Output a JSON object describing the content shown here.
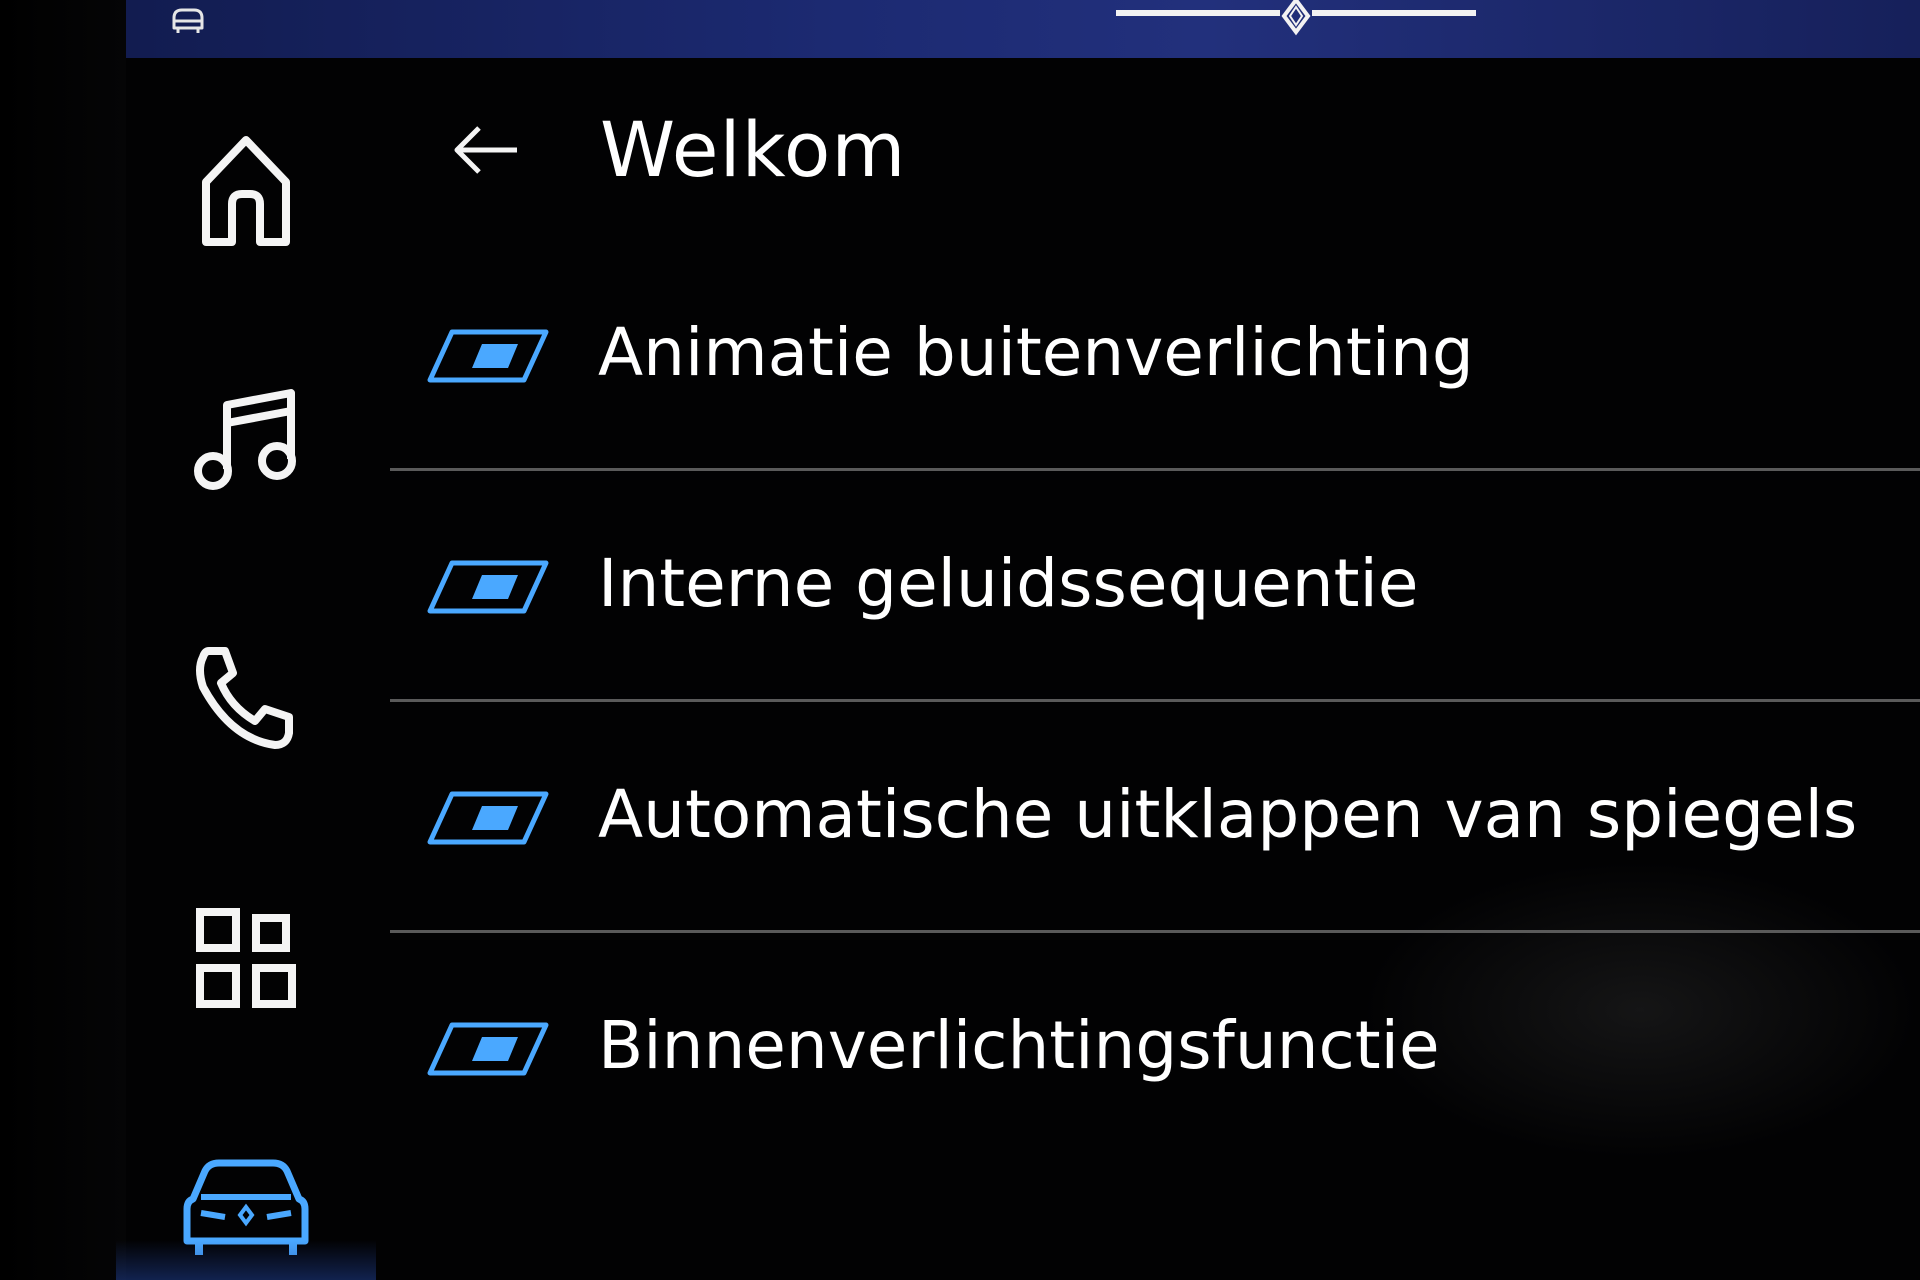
{
  "top_bar": {
    "car_icon": "car-outline-icon",
    "indicator_icon": "brand-diamond-icon",
    "accent_color": "#1c2a72"
  },
  "sidebar": {
    "items": [
      {
        "id": "home",
        "icon": "home-icon",
        "active": false
      },
      {
        "id": "music",
        "icon": "music-note-icon",
        "active": false
      },
      {
        "id": "phone",
        "icon": "phone-icon",
        "active": false
      },
      {
        "id": "apps",
        "icon": "apps-grid-icon",
        "active": false
      },
      {
        "id": "car",
        "icon": "car-icon",
        "active": true
      }
    ],
    "active_color": "#4aa8ff"
  },
  "header": {
    "back_icon": "arrow-left-icon",
    "title": "Welkom"
  },
  "menu": {
    "items": [
      {
        "label": "Animatie buitenverlichting",
        "icon": "parallelogram-icon"
      },
      {
        "label": "Interne geluidssequentie",
        "icon": "parallelogram-icon"
      },
      {
        "label": "Automatische uitklappen van spiegels",
        "icon": "parallelogram-icon"
      },
      {
        "label": "Binnenverlichtingsfunctie",
        "icon": "parallelogram-icon"
      }
    ],
    "icon_color": "#4aa8ff"
  }
}
